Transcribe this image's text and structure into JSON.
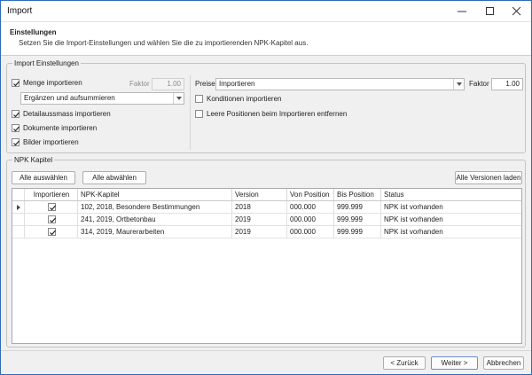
{
  "window": {
    "title": "Import"
  },
  "header": {
    "title": "Einstellungen",
    "subtitle": "Setzen Sie die Import-Einstellungen und wählen Sie die zu importierenden NPK-Kapitel aus."
  },
  "settings": {
    "legend": "Import Einstellungen",
    "menge_label": "Menge importieren",
    "menge_checked": true,
    "faktor_left_label": "Faktor",
    "faktor_left_value": "1.00",
    "menge_mode": "Ergänzen und aufsummieren",
    "detail_label": "Detailaussmass importieren",
    "detail_checked": true,
    "dokumente_label": "Dokumente importieren",
    "dokumente_checked": true,
    "bilder_label": "Bilder importieren",
    "bilder_checked": true,
    "preise_label": "Preise",
    "preise_value": "Importieren",
    "faktor_right_label": "Faktor",
    "faktor_right_value": "1.00",
    "konditionen_label": "Konditionen importieren",
    "konditionen_checked": false,
    "leere_label": "Leere Positionen beim Importieren entfernen",
    "leere_checked": false
  },
  "npk": {
    "legend": "NPK Kapitel",
    "select_all": "Alle auswählen",
    "deselect_all": "Alle abwählen",
    "load_versions": "Alle Versionen laden",
    "columns": [
      "Importieren",
      "NPK-Kapitel",
      "Version",
      "Von Position",
      "Bis Position",
      "Status"
    ],
    "rows": [
      {
        "checked": true,
        "kapitel": "102, 2018, Besondere Bestimmungen",
        "version": "2018",
        "von": "000.000",
        "bis": "999.999",
        "status": "NPK ist vorhanden",
        "current": true
      },
      {
        "checked": true,
        "kapitel": "241, 2019, Ortbetonbau",
        "version": "2019",
        "von": "000.000",
        "bis": "999.999",
        "status": "NPK ist vorhanden",
        "current": false
      },
      {
        "checked": true,
        "kapitel": "314, 2019, Maurerarbeiten",
        "version": "2019",
        "von": "000.000",
        "bis": "999.999",
        "status": "NPK ist vorhanden",
        "current": false
      }
    ]
  },
  "footer": {
    "back": "< Zurück",
    "next": "Weiter >",
    "cancel": "Abbrechen"
  }
}
